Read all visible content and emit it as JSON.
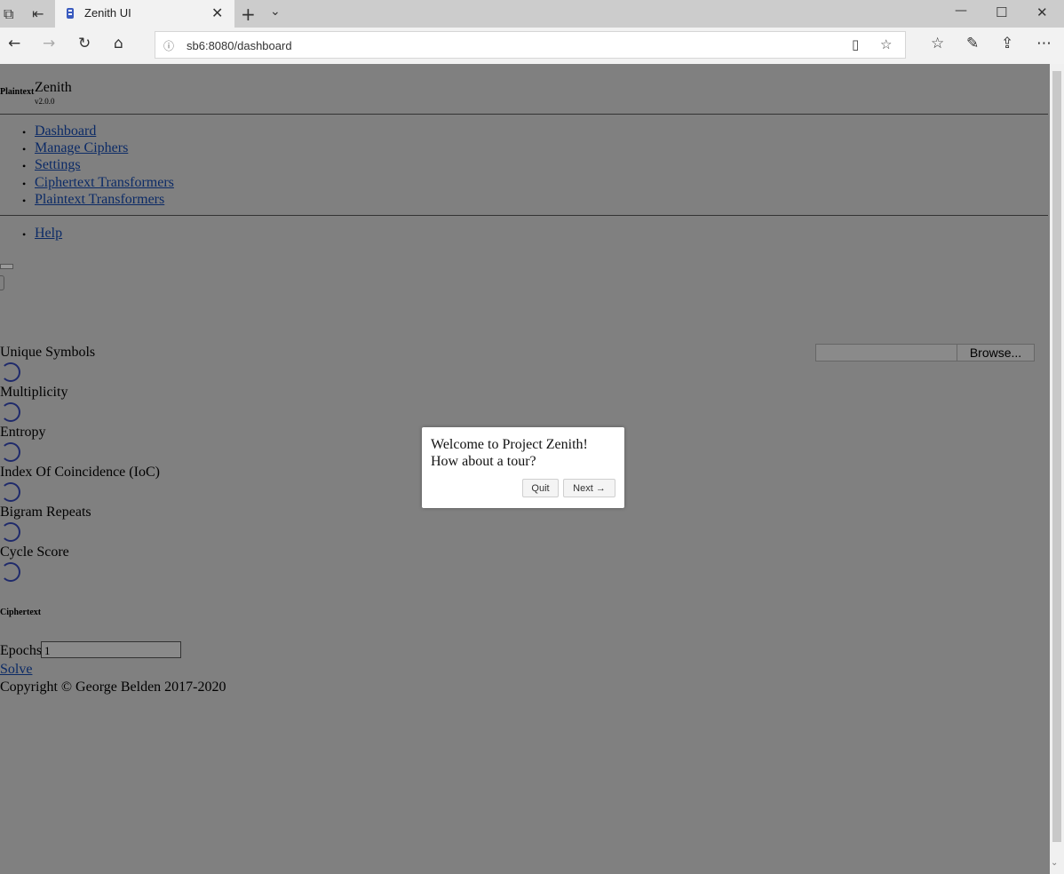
{
  "browser": {
    "tab_title": "Zenith UI",
    "url": "sb6:8080/dashboard"
  },
  "header": {
    "logo_alt": "Plaintext",
    "app_name": "Zenith",
    "version": "v2.0.0"
  },
  "nav": {
    "items": [
      "Dashboard",
      "Manage Ciphers",
      "Settings",
      "Ciphertext Transformers",
      "Plaintext Transformers"
    ],
    "help": "Help"
  },
  "stats": {
    "labels": [
      "Unique Symbols",
      "Multiplicity",
      "Entropy",
      "Index Of Coincidence (IoC)",
      "Bigram Repeats",
      "Cycle Score"
    ]
  },
  "file_input": {
    "button_label": "Browse..."
  },
  "ciphertext_heading": "Ciphertext",
  "epochs": {
    "label": "Epochs",
    "value": "1"
  },
  "solve_link": "Solve",
  "footer": {
    "copyright": "Copyright © George Belden 2017-2020"
  },
  "tour": {
    "line1": "Welcome to Project Zenith!",
    "line2": "How about a tour?",
    "quit_label": "Quit",
    "next_label": "Next →"
  }
}
